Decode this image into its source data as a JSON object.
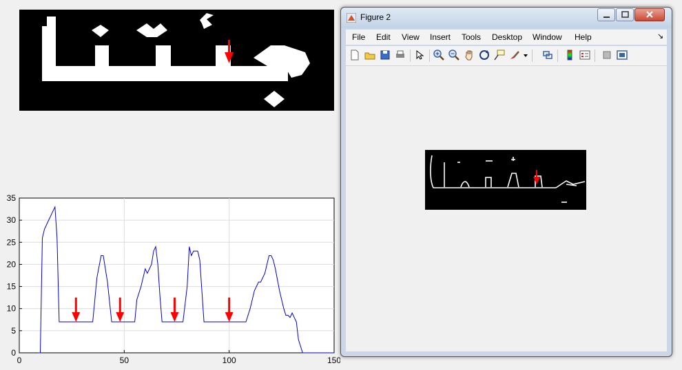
{
  "binary_image": {
    "marker_color": "#ff0000"
  },
  "chart_data": {
    "type": "line",
    "x": [
      9,
      9.5,
      10,
      11,
      12,
      14,
      16,
      17,
      18,
      19,
      20,
      22,
      25,
      28,
      30,
      35,
      37,
      39,
      40,
      42,
      44,
      47,
      50,
      55,
      56,
      58,
      60,
      61,
      62,
      63,
      64,
      65,
      66,
      67,
      68,
      70,
      72,
      75,
      78,
      80,
      81,
      82,
      83,
      84,
      85,
      86,
      88,
      90,
      95,
      100,
      105,
      108,
      110,
      112,
      114,
      115,
      116,
      117,
      118,
      119,
      120,
      121,
      122,
      124,
      126,
      127,
      128,
      129,
      130,
      131,
      132,
      133,
      135,
      136,
      137,
      140,
      145,
      150
    ],
    "values": [
      0,
      0,
      0,
      26,
      28,
      30,
      32,
      33,
      26,
      7,
      7,
      7,
      7,
      7,
      7,
      7,
      17,
      22,
      22,
      16,
      7,
      7,
      7,
      7,
      12,
      15,
      19,
      18,
      19,
      20,
      23,
      24,
      20,
      13,
      7,
      7,
      7,
      7,
      7,
      15,
      24,
      22,
      23,
      23,
      23,
      21,
      7,
      7,
      7,
      7,
      7,
      7,
      10,
      14,
      16,
      16,
      17,
      18,
      20,
      22,
      22,
      21,
      19,
      14,
      10,
      8.5,
      8.5,
      8,
      9,
      8,
      7,
      3,
      0,
      0,
      0,
      0,
      0,
      0
    ],
    "color": "#0000cc",
    "xlim": [
      0,
      150
    ],
    "ylim": [
      0,
      35
    ],
    "xticks": [
      0,
      50,
      100,
      150
    ],
    "yticks": [
      0,
      5,
      10,
      15,
      20,
      25,
      30,
      35
    ],
    "grid": true,
    "markers_x": [
      27,
      48,
      74,
      100
    ],
    "marker_color": "#ff0000"
  },
  "figure_window": {
    "title": "Figure 2",
    "menu": [
      "File",
      "Edit",
      "View",
      "Insert",
      "Tools",
      "Desktop",
      "Window",
      "Help"
    ],
    "toolbar_icons": [
      "new-figure-icon",
      "open-file-icon",
      "save-icon",
      "print-icon",
      "edit-plot-icon",
      "zoom-in-icon",
      "zoom-out-icon",
      "pan-icon",
      "rotate-3d-icon",
      "data-cursor-icon",
      "brush-icon",
      "link-plot-icon",
      "colorbar-icon",
      "legend-icon",
      "hide-plot-tools-icon",
      "show-plot-tools-icon"
    ],
    "dock_arrow": "↘"
  }
}
